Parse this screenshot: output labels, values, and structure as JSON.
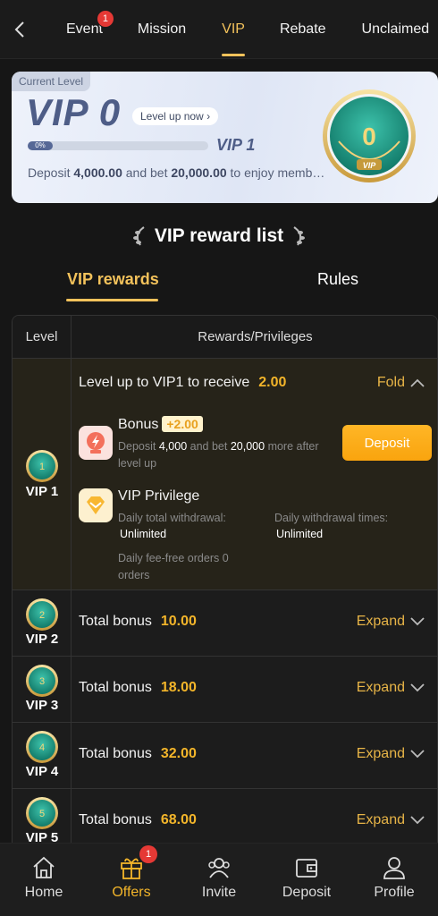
{
  "nav": {
    "tabs": [
      {
        "label": "Event",
        "badge": "1"
      },
      {
        "label": "Mission"
      },
      {
        "label": "VIP",
        "active": true
      },
      {
        "label": "Rebate"
      },
      {
        "label": "Unclaimed"
      }
    ]
  },
  "vip_card": {
    "current_level_label": "Current Level",
    "level": "VIP 0",
    "level_up_label": "Level up now",
    "progress_text": "0%",
    "progress": 0,
    "next_level": "VIP 1",
    "deposit_prefix": "Deposit",
    "deposit_amount": "4,000.00",
    "bet_mid": "and bet",
    "bet_amount": "20,000.00",
    "deposit_suffix": "to enjoy memb…",
    "medal_number": "0",
    "medal_tag": "VIP"
  },
  "reward_list": {
    "title": "VIP reward list",
    "tabs": [
      "VIP rewards",
      "Rules"
    ]
  },
  "table": {
    "header_level": "Level",
    "header_rewards": "Rewards/Privileges",
    "expanded_row": {
      "level": "VIP 1",
      "medal_number": "1",
      "title": "Level up to VIP1 to receive",
      "amount": "2.00",
      "toggle": "Fold",
      "bonus_title": "Bonus",
      "bonus_badge": "+2.00",
      "bonus_desc_1": "Deposit",
      "bonus_deposit": "4,000",
      "bonus_desc_2": "and bet",
      "bonus_bet": "20,000",
      "bonus_desc_3": "more after level up",
      "deposit_button": "Deposit",
      "privilege_title": "VIP Privilege",
      "daily_withdrawal_label": "Daily total withdrawal:",
      "daily_withdrawal_value": "Unlimited",
      "withdrawal_times_label": "Daily withdrawal times:",
      "withdrawal_times_value": "Unlimited",
      "fee_free_label": "Daily fee-free orders 0 orders"
    },
    "rows": [
      {
        "level": "VIP 2",
        "medal_number": "2",
        "label": "Total bonus",
        "amount": "10.00",
        "toggle": "Expand"
      },
      {
        "level": "VIP 3",
        "medal_number": "3",
        "label": "Total bonus",
        "amount": "18.00",
        "toggle": "Expand"
      },
      {
        "level": "VIP 4",
        "medal_number": "4",
        "label": "Total bonus",
        "amount": "32.00",
        "toggle": "Expand"
      },
      {
        "level": "VIP 5",
        "medal_number": "5",
        "label": "Total bonus",
        "amount": "68.00",
        "toggle": "Expand"
      }
    ]
  },
  "bottom_nav": [
    {
      "label": "Home",
      "icon": "home-icon"
    },
    {
      "label": "Offers",
      "icon": "gift-icon",
      "badge": "1",
      "active": true
    },
    {
      "label": "Invite",
      "icon": "users-icon"
    },
    {
      "label": "Deposit",
      "icon": "wallet-icon"
    },
    {
      "label": "Profile",
      "icon": "profile-icon"
    }
  ],
  "colors": {
    "accent": "#f3c25b",
    "amount": "#f3b52a",
    "button": "#f9a40e",
    "badge": "#e53935",
    "medal": "#1d9a86"
  }
}
